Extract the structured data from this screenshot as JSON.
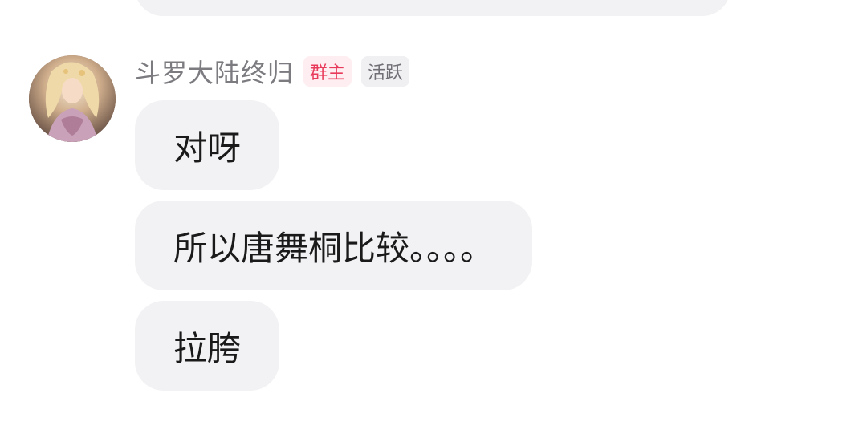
{
  "sender": {
    "name": "斗罗大陆终归",
    "avatar_icon": "avatar-image",
    "badges": [
      {
        "label": "群主",
        "kind": "owner",
        "color": "#e83b5c"
      },
      {
        "label": "活跃",
        "kind": "active",
        "color": "#6f6f75"
      }
    ]
  },
  "messages": [
    {
      "text": "对呀"
    },
    {
      "text": "所以唐舞桐比较。。。。"
    },
    {
      "text": "拉胯"
    }
  ],
  "colors": {
    "bubble_bg": "#f2f2f4",
    "text": "#1a1a1a",
    "username": "#7b7b80"
  }
}
